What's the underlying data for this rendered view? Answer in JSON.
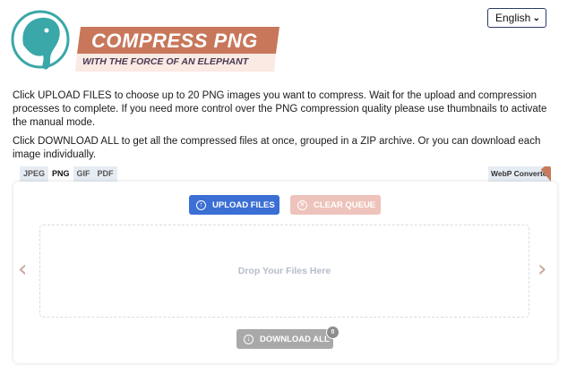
{
  "logo": {
    "title": "COMPRESS PNG",
    "tagline": "WITH THE FORCE OF AN ELEPHANT",
    "icon": "elephant-icon"
  },
  "language": {
    "selected": "English",
    "icon": "chevron-down-icon"
  },
  "description": {
    "p1": "Click UPLOAD FILES to choose up to 20 PNG images you want to compress. Wait for the upload and compression processes to complete. If you need more control over the PNG compression quality please use thumbnails to activate the manual mode.",
    "p2": "Click DOWNLOAD ALL to get all the compressed files at once, grouped in a ZIP archive. Or you can download each image individually."
  },
  "tabs": [
    {
      "label": "JPEG",
      "active": false
    },
    {
      "label": "PNG",
      "active": true
    },
    {
      "label": "GIF",
      "active": false
    },
    {
      "label": "PDF",
      "active": false
    }
  ],
  "webp_converter": {
    "label": "WebP Converter"
  },
  "buttons": {
    "upload": {
      "label": "UPLOAD FILES",
      "icon": "arrow-up-circle-icon"
    },
    "clear": {
      "label": "CLEAR QUEUE",
      "icon": "x-circle-icon"
    },
    "download": {
      "label": "DOWNLOAD ALL",
      "icon": "arrow-down-circle-icon",
      "count": "0"
    }
  },
  "dropzone": {
    "label": "Drop Your Files Here"
  },
  "carousel": {
    "prev_icon": "chevron-left-icon",
    "next_icon": "chevron-right-icon"
  },
  "colors": {
    "upload": "#3b6fd4",
    "clear": "#eec3bb",
    "download": "#a9a9a9",
    "logo_banner": "#c8775a",
    "elephant": "#3aa7a8"
  }
}
